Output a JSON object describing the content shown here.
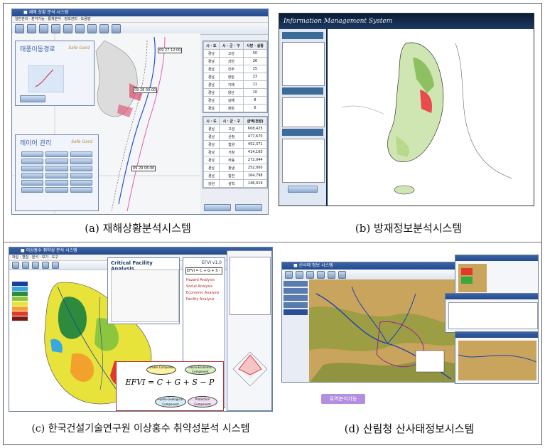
{
  "captions": {
    "a": "(a) 재해상황분석시스템",
    "b": "(b) 방재정보분석시스템",
    "c": "(c) 한국건설기술연구원 이상홍수 취약성분석 시스템",
    "d": "(d) 산림청 산사태정보시스템"
  },
  "panel_a": {
    "typhoon_window_title": "태풍이동경로",
    "layer_window_title": "레이어 관리",
    "brand": "Safe Gard",
    "table1_headers": [
      "시 · 도",
      "시 · 군 · 구",
      "사망 · 실종"
    ],
    "table1_rows": [
      [
        "경남",
        "고성",
        "50"
      ],
      [
        "경남",
        "과천",
        "26"
      ],
      [
        "경남",
        "진주",
        "25"
      ],
      [
        "경남",
        "창원",
        "23"
      ],
      [
        "경남",
        "거제",
        "11"
      ],
      [
        "경남",
        "양산",
        "10"
      ],
      [
        "경남",
        "김해",
        "8"
      ],
      [
        "경남",
        "창원",
        "6"
      ]
    ],
    "table2_headers": [
      "시 · 도",
      "시 · 군 · 구",
      "금액(천원)"
    ],
    "table2_rows": [
      [
        "경남",
        "고성",
        "608,425"
      ],
      [
        "경남",
        "산청",
        "477,670"
      ],
      [
        "경남",
        "함양",
        "452,371"
      ],
      [
        "경남",
        "거창",
        "414,165"
      ],
      [
        "경남",
        "하동",
        "272,044"
      ],
      [
        "경남",
        "창녕",
        "252,000"
      ],
      [
        "경남",
        "합천",
        "164,798"
      ],
      [
        "강원",
        "삼척",
        "146,019"
      ]
    ]
  },
  "panel_b": {
    "header": "Information Management System"
  },
  "panel_c": {
    "dialog_title": "Critical Facility Analysis",
    "app_title": "EFVI v1.0",
    "formula_bar": "EFVI = C + G + S - P",
    "equation": "EFVI  =  C  +  G  +  S  −  P",
    "components": [
      "Climate Component",
      "Socio-Economic Component",
      "Hydro-Geological Component",
      "Protection Component"
    ],
    "analysis_items": [
      "Hazard Analysis",
      "Social Analysis",
      "Economic Analysis",
      "Facility Analysis"
    ]
  },
  "panel_d": {
    "button_label": "유역분석기능"
  },
  "colors": {
    "accent": "#3b63a8",
    "map_green": "#8cc061",
    "button_purple": "#b48ee0"
  }
}
